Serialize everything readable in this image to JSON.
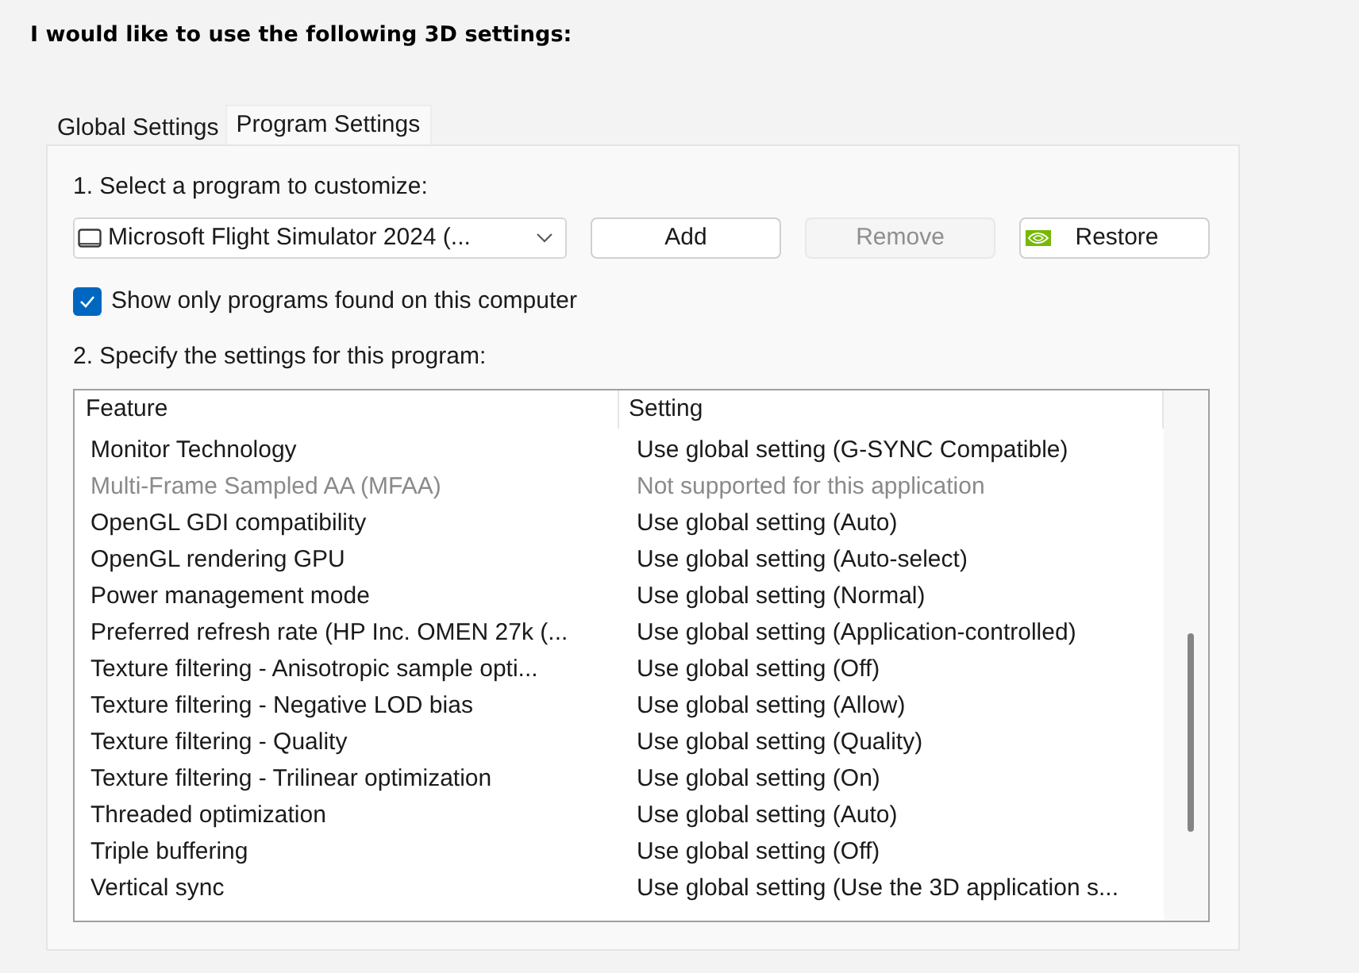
{
  "heading": "I would like to use the following 3D settings:",
  "tabs": [
    {
      "label": "Global Settings",
      "selected": false
    },
    {
      "label": "Program Settings",
      "selected": true
    }
  ],
  "program_section": {
    "label": "1. Select a program to customize:",
    "program_select": {
      "value": "Microsoft Flight Simulator 2024 (..."
    },
    "buttons": [
      {
        "label": "Add",
        "disabled": false,
        "kind": "plain"
      },
      {
        "label": "Remove",
        "disabled": true,
        "kind": "plain"
      },
      {
        "label": "Restore",
        "disabled": false,
        "kind": "icon"
      }
    ]
  },
  "show_only_found": {
    "label": "Show only programs found on this computer",
    "checked": true
  },
  "settings_section": {
    "label": "2. Specify the settings for this program:",
    "table": {
      "columns": [
        "Feature",
        "Setting"
      ],
      "rows": [
        {
          "feature": "Monitor Technology",
          "setting": "Use global setting (G-SYNC Compatible)",
          "disabled": false
        },
        {
          "feature": "Multi-Frame Sampled AA (MFAA)",
          "setting": "Not supported for this application",
          "disabled": true
        },
        {
          "feature": "OpenGL GDI compatibility",
          "setting": "Use global setting (Auto)",
          "disabled": false
        },
        {
          "feature": "OpenGL rendering GPU",
          "setting": "Use global setting (Auto-select)",
          "disabled": false
        },
        {
          "feature": "Power management mode",
          "setting": "Use global setting (Normal)",
          "disabled": false
        },
        {
          "feature": "Preferred refresh rate (HP Inc. OMEN 27k (...",
          "setting": "Use global setting (Application-controlled)",
          "disabled": false
        },
        {
          "feature": "Texture filtering - Anisotropic sample opti...",
          "setting": "Use global setting (Off)",
          "disabled": false
        },
        {
          "feature": "Texture filtering - Negative LOD bias",
          "setting": "Use global setting (Allow)",
          "disabled": false
        },
        {
          "feature": "Texture filtering - Quality",
          "setting": "Use global setting (Quality)",
          "disabled": false
        },
        {
          "feature": "Texture filtering - Trilinear optimization",
          "setting": "Use global setting (On)",
          "disabled": false
        },
        {
          "feature": "Threaded optimization",
          "setting": "Use global setting (Auto)",
          "disabled": false
        },
        {
          "feature": "Triple buffering",
          "setting": "Use global setting (Off)",
          "disabled": false
        },
        {
          "feature": "Vertical sync",
          "setting": "Use global setting (Use the 3D application s...",
          "disabled": false
        }
      ]
    }
  }
}
